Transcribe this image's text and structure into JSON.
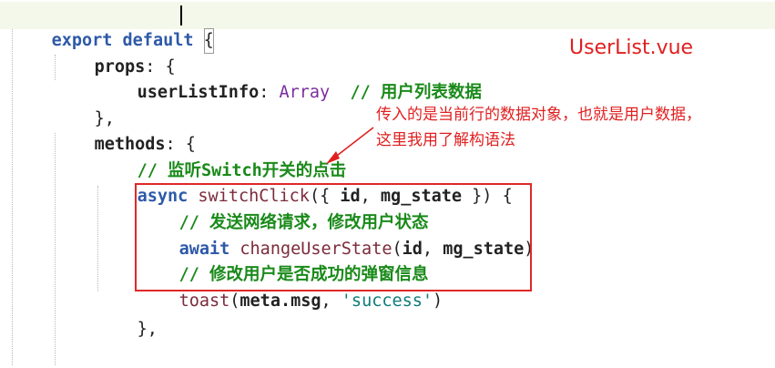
{
  "code": {
    "line1": {
      "kw": "export default",
      "brace": "{"
    },
    "line2": {
      "prop": "props",
      "punct": ": {"
    },
    "line3": {
      "prop": "userListInfo",
      "punct": ": ",
      "type": "Array",
      "comment": "// 用户列表数据"
    },
    "line4": {
      "punct": "},"
    },
    "line5": {
      "prop": "methods",
      "punct": ": {"
    },
    "line6": {
      "comment": "// 监听Switch开关的点击"
    },
    "line7": {
      "kw": "async",
      "fn": "switchClick",
      "open": "({ ",
      "p1": "id",
      "comma": ", ",
      "p2": "mg_state",
      "close": " }) {"
    },
    "line8": {
      "comment": "// 发送网络请求，修改用户状态"
    },
    "line9": {
      "kw": "await",
      "fn": "changeUserState",
      "open": "(",
      "p1": "id",
      "comma": ", ",
      "p2": "mg_state",
      "close": ")"
    },
    "line10": {
      "comment": "// 修改用户是否成功的弹窗信息"
    },
    "line11": {
      "fn": "toast",
      "open": "(",
      "p1": "meta.msg",
      "comma": ", ",
      "str": "'success'",
      "close": ")"
    },
    "line12": {
      "punct": "},"
    }
  },
  "annotations": {
    "file_label": "UserList.vue",
    "note_line1": "传入的是当前行的数据对象，也就是用户数据，",
    "note_line2": "这里我用了解构语法"
  },
  "colors": {
    "keyword": "#2e59a8",
    "type": "#7b2e9e",
    "comment": "#1a8a1a",
    "string": "#0f7b7b",
    "annotation_red": "#e02020"
  }
}
